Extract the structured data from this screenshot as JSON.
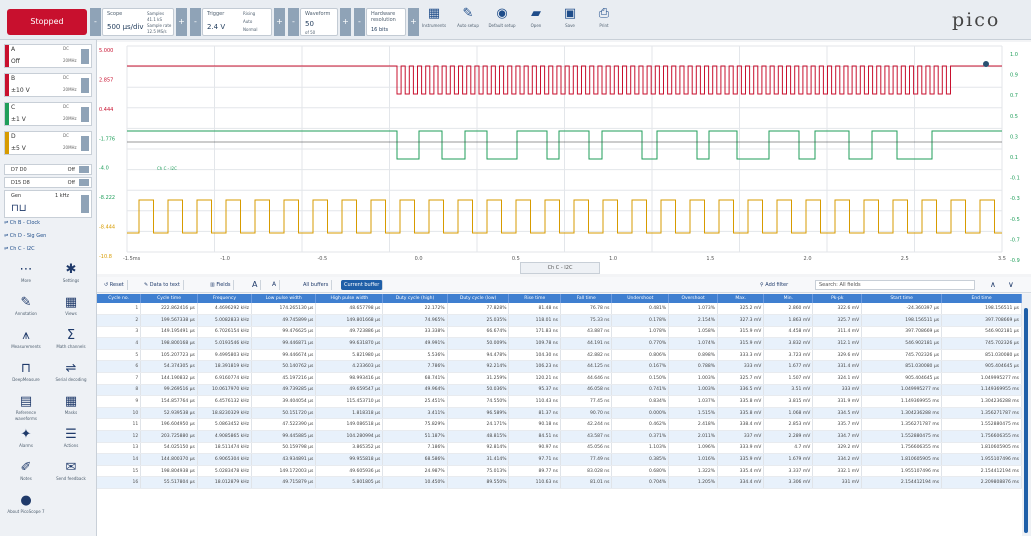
{
  "toolbar": {
    "run_state": "Stopped",
    "scope": {
      "label": "Scope",
      "value": "500 µs/div",
      "samples": "Samples",
      "samples_val": "41.1 kS",
      "rate": "Sample rate",
      "rate_val": "12.5 MS/s"
    },
    "trigger": {
      "label": "Trigger",
      "value": "2.4 V",
      "mode_label": "Rising",
      "edge": "Auto",
      "type": "Normal"
    },
    "waveform": {
      "label": "Waveform",
      "value": "50",
      "of": "of 50"
    },
    "resolution": {
      "label": "Hardware resolution",
      "value": "16 bits"
    },
    "icons": [
      {
        "name": "instruments-icon",
        "glyph": "▦",
        "label": "Instruments"
      },
      {
        "name": "auto-setup-icon",
        "glyph": "✎",
        "label": "Auto setup"
      },
      {
        "name": "default-setup-icon",
        "glyph": "◉",
        "label": "Default setup"
      },
      {
        "name": "open-icon",
        "glyph": "▰",
        "label": "Open"
      },
      {
        "name": "save-icon",
        "glyph": "▣",
        "label": "Save"
      },
      {
        "name": "print-icon",
        "glyph": "⎙",
        "label": "Print"
      }
    ],
    "logo": "pico"
  },
  "channels": [
    {
      "name": "A",
      "range": "Off",
      "coupling": "DC",
      "setting": "20MHz",
      "color": "#c8102e"
    },
    {
      "name": "B",
      "range": "±10 V",
      "coupling": "DC",
      "setting": "20MHz",
      "color": "#c8102e"
    },
    {
      "name": "C",
      "range": "±1 V",
      "coupling": "DC",
      "setting": "20MHz",
      "color": "#1f9e5a"
    },
    {
      "name": "D",
      "range": "±5 V",
      "coupling": "DC",
      "setting": "20MHz",
      "color": "#d79b00"
    }
  ],
  "digital": [
    {
      "name": "D7 D0",
      "state": "Off"
    },
    {
      "name": "D15 D8",
      "state": "Off"
    }
  ],
  "generator": {
    "label": "Gen",
    "freq": "1 kHz"
  },
  "math": [
    {
      "label": "Ch B - Clock"
    },
    {
      "label": "Ch D - Sig Gen"
    },
    {
      "label": "Ch C - I2C"
    }
  ],
  "tools": [
    {
      "name": "more-icon",
      "glyph": "⋯",
      "label": "More"
    },
    {
      "name": "settings-icon",
      "glyph": "✱",
      "label": "Settings"
    },
    {
      "name": "annotation-icon",
      "glyph": "✎",
      "label": "Annotation"
    },
    {
      "name": "views-icon",
      "glyph": "▦",
      "label": "Views"
    },
    {
      "name": "measurements-icon",
      "glyph": "⩚",
      "label": "Measurements"
    },
    {
      "name": "math-channels-icon",
      "glyph": "Σ",
      "label": "Math channels"
    },
    {
      "name": "deepmeasure-icon",
      "glyph": "⊓",
      "label": "DeepMeasure"
    },
    {
      "name": "serial-decoding-icon",
      "glyph": "⇌",
      "label": "Serial decoding"
    },
    {
      "name": "reference-waveforms-icon",
      "glyph": "▤",
      "label": "Reference waveforms"
    },
    {
      "name": "masks-icon",
      "glyph": "▦",
      "label": "Masks"
    },
    {
      "name": "alarms-icon",
      "glyph": "✦",
      "label": "Alarms"
    },
    {
      "name": "actions-icon",
      "glyph": "☰",
      "label": "Actions"
    },
    {
      "name": "notes-icon",
      "glyph": "✐",
      "label": "Notes"
    },
    {
      "name": "send-feedback-icon",
      "glyph": "✉",
      "label": "Send feedback"
    },
    {
      "name": "about-icon",
      "glyph": "●",
      "label": "About PicoScope 7"
    }
  ],
  "scope": {
    "y_left": [
      "5.000",
      "2.857",
      "0.444",
      "-1.776",
      "-4.0",
      "-8.222",
      "-8.444",
      "-10.8"
    ],
    "y_right": [
      "1.0",
      "0.9",
      "0.7",
      "0.5",
      "0.3",
      "0.1",
      "-0.1",
      "-0.3",
      "-0.5",
      "-0.7",
      "-0.9"
    ],
    "x_ticks": [
      "-1.5ms",
      "-1.0",
      "-0.5",
      "0.0",
      "0.5",
      "1.0",
      "1.5",
      "2.0",
      "2.5",
      "3.5"
    ],
    "tab": "Ch C - I2C",
    "annot": "Ch C - I2C"
  },
  "mbar": {
    "items": [
      "Reset",
      "Data to text",
      "Fields",
      "A",
      "A",
      "All buffers",
      "Current buffer"
    ],
    "filter": "Add filter",
    "search": "Search: All fields"
  },
  "table": {
    "headers": [
      "Cycle no.",
      "Cycle time",
      "Frequency",
      "Low pulse width",
      "High pulse width",
      "Duty cycle (high)",
      "Duty cycle (low)",
      "Rise time",
      "Fall time",
      "Undershoot",
      "Overshoot",
      "Max.",
      "Min.",
      "Pk-pk",
      "Start time",
      "End time"
    ],
    "rows": [
      [
        "1",
        "222.862416 µs",
        "4.4696292 kHz",
        "174.265130 µs",
        "48.657798 µs",
        "22.172%",
        "77.828%",
        "81.48 ns",
        "76.78 ns",
        "0.481%",
        "1.073%",
        "325.2 mV",
        "2.860 mV",
        "322.6 mV",
        "-24.360397 µs",
        "198.156511 µs"
      ],
      [
        "2",
        "199.567338 µs",
        "5.0082833 kHz",
        "49.745899 µs",
        "149.801668 µs",
        "74.965%",
        "25.035%",
        "118.01 ns",
        "75.33 ns",
        "0.178%",
        "2.154%",
        "327.3 mV",
        "1.863 mV",
        "325.7 mV",
        "198.156511 µs",
        "397.708669 µs"
      ],
      [
        "3",
        "149.195491 µs",
        "6.7026154 kHz",
        "99.476625 µs",
        "49.723886 µs",
        "33.338%",
        "66.674%",
        "171.83 ns",
        "43.887 ns",
        "1.078%",
        "1.058%",
        "315.9 mV",
        "4.458 mV",
        "311.4 mV",
        "397.708669 µs",
        "546.902181 µs"
      ],
      [
        "4",
        "198.800168 µs",
        "5.0193546 kHz",
        "99.446871 µs",
        "99.631870 µs",
        "49.991%",
        "50.009%",
        "109.78 ns",
        "44.191 ns",
        "0.770%",
        "1.074%",
        "315.9 mV",
        "3.832 mV",
        "312.1 mV",
        "546.902181 µs",
        "745.702326 µs"
      ],
      [
        "5",
        "105.207723 µs",
        "9.4995803 kHz",
        "99.446674 µs",
        "5.821980 µs",
        "5.536%",
        "94.478%",
        "104.30 ns",
        "42.882 ns",
        "0.806%",
        "0.898%",
        "333.3 mV",
        "3.723 mV",
        "329.6 mV",
        "745.702326 µs",
        "851.030080 µs"
      ],
      [
        "6",
        "54.374305 µs",
        "18.391819 kHz",
        "50.140762 µs",
        "4.233603 µs",
        "7.786%",
        "92.214%",
        "106.23 ns",
        "44.125 ns",
        "0.167%",
        "0.788%",
        "333 mV",
        "1.677 mV",
        "331.4 mV",
        "851.030080 µs",
        "905.404645 µs"
      ],
      [
        "7",
        "144.190832 µs",
        "6.9160774 kHz",
        "45.197216 µs",
        "98.993416 µs",
        "68.741%",
        "31.259%",
        "120.21 ns",
        "44.646 ns",
        "0.150%",
        "1.003%",
        "325.7 mV",
        "1.507 mV",
        "324.1 mV",
        "905.404645 µs",
        "1.049995277 ms"
      ],
      [
        "8",
        "99.269516 µs",
        "10.0617970 kHz",
        "49.739285 µs",
        "49.659547 µs",
        "49.964%",
        "50.036%",
        "95.37 ns",
        "46.058 ns",
        "0.741%",
        "1.003%",
        "336.5 mV",
        "3.51 mV",
        "333 mV",
        "1.049995277 ms",
        "1.149369955 ms"
      ],
      [
        "9",
        "154.857764 µs",
        "6.4576132 kHz",
        "39.404054 µs",
        "115.453710 µs",
        "25.451%",
        "74.550%",
        "110.43 ns",
        "77.45 ns",
        "0.834%",
        "1.037%",
        "335.8 mV",
        "3.815 mV",
        "331.9 mV",
        "1.149369955 ms",
        "1.304236288 ms"
      ],
      [
        "10",
        "52.939538 µs",
        "18.8230329 kHz",
        "50.151720 µs",
        "1.818318 µs",
        "3.411%",
        "96.589%",
        "81.37 ns",
        "90.70 ns",
        "0.000%",
        "1.515%",
        "335.8 mV",
        "1.068 mV",
        "334.5 mV",
        "1.304236288 ms",
        "1.356271787 ms"
      ],
      [
        "11",
        "196.604950 µs",
        "5.0863452 kHz",
        "47.522390 µs",
        "149.086518 µs",
        "75.829%",
        "24.171%",
        "90.18 ns",
        "42.244 ns",
        "0.462%",
        "2.418%",
        "338.4 mV",
        "2.853 mV",
        "335.7 mV",
        "1.356271787 ms",
        "1.552880475 ms"
      ],
      [
        "12",
        "203.725880 µs",
        "4.9085865 kHz",
        "99.445885 µs",
        "104.280994 µs",
        "51.187%",
        "48.815%",
        "84.51 ns",
        "43.587 ns",
        "0.371%",
        "2.011%",
        "337 mV",
        "2.289 mV",
        "334.7 mV",
        "1.552880475 ms",
        "1.756606355 ms"
      ],
      [
        "13",
        "54.025150 µs",
        "18.511474 kHz",
        "50.159798 µs",
        "3.865352 µs",
        "7.186%",
        "92.814%",
        "90.97 ns",
        "45.056 ns",
        "1.103%",
        "1.096%",
        "333.9 mV",
        "4.7 mV",
        "329.2 mV",
        "1.756606355 ms",
        "1.810605905 ms"
      ],
      [
        "14",
        "144.800370 µs",
        "6.9065304 kHz",
        "43.934891 µs",
        "99.955818 µs",
        "68.586%",
        "31.414%",
        "97.71 ns",
        "77.49 ns",
        "0.385%",
        "1.016%",
        "335.9 mV",
        "1.679 mV",
        "334.2 mV",
        "1.810605905 ms",
        "1.955107496 ms"
      ],
      [
        "15",
        "198.804938 µs",
        "5.0283478 kHz",
        "149.172003 µs",
        "49.605936 µs",
        "24.987%",
        "75.013%",
        "89.77 ns",
        "83.028 ns",
        "0.680%",
        "1.322%",
        "335.4 mV",
        "3.337 mV",
        "332.1 mV",
        "1.955107496 ms",
        "2.154412194 ms"
      ],
      [
        "16",
        "55.517804 µs",
        "18.012879 kHz",
        "49.715879 µs",
        "5.801805 µs",
        "10.450%",
        "89.550%",
        "110.63 ns",
        "81.01 ns",
        "0.704%",
        "1.205%",
        "334.4 mV",
        "3.306 mV",
        "331 mV",
        "2.154412194 ms",
        "2.209808876 ms"
      ]
    ]
  }
}
